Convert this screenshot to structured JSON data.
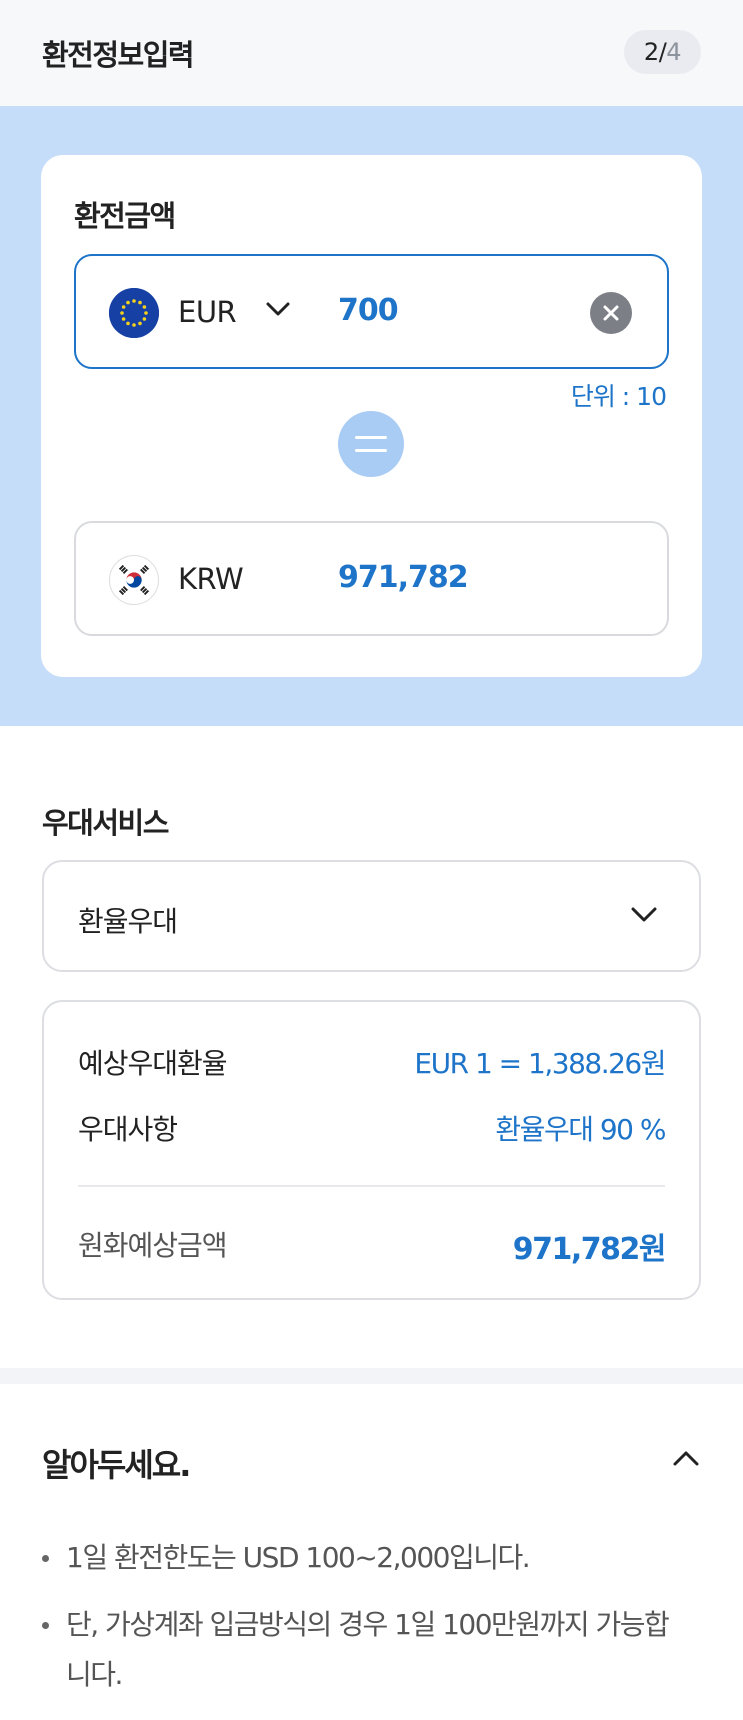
{
  "header": {
    "title": "환전정보입력",
    "step_current": "2",
    "step_separator": "/",
    "step_total": "4"
  },
  "exchange": {
    "title": "환전금액",
    "from": {
      "currency": "EUR",
      "amount": "700",
      "flag_icon": "eu-flag-icon"
    },
    "unit_text": "단위 : 10",
    "to": {
      "currency": "KRW",
      "amount": "971,782",
      "flag_icon": "kr-flag-icon"
    }
  },
  "benefit": {
    "title": "우대서비스",
    "selected_option": "환율우대",
    "details": {
      "rate_label": "예상우대환율",
      "rate_value": "EUR 1 = 1,388.26원",
      "benefit_label": "우대사항",
      "benefit_value": "환율우대 90 %",
      "total_label": "원화예상금액",
      "total_value": "971,782원"
    }
  },
  "notice": {
    "title": "알아두세요.",
    "items": [
      "1일 환전한도는 USD 100~2,000입니다.",
      "단, 가상계좌 입금방식의 경우 1일 100만원까지 가능합니다."
    ]
  },
  "colors": {
    "accent": "#1d74c9",
    "hero_background": "#c5ddf8",
    "equals_circle": "#a9ccf5",
    "clear_button": "#7c8086"
  }
}
